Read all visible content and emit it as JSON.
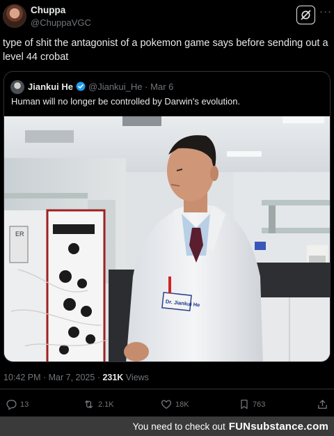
{
  "tweet": {
    "author_name": "Chuppa",
    "author_handle": "@ChuppaVGC",
    "text": "type of shit the antagonist of a pokemon game says before sending out a level 44 crobat",
    "timestamp": "10:42 PM · Mar 7, 2025 · ",
    "views_count": "231K",
    "views_label": " Views"
  },
  "quoted": {
    "author_name": "Jiankui He",
    "author_handle": "@Jiankui_He · Mar 6",
    "text": "Human will no longer be controlled by Darwin's evolution.",
    "badge_text": "Dr. Jiankui He",
    "device_label": "ER"
  },
  "actions": {
    "replies": "13",
    "reposts": "2.1K",
    "likes": "18K",
    "bookmarks": "763"
  },
  "banner": {
    "prefix": "You need to check out",
    "brand": "FUNsubstance.com"
  },
  "colors": {
    "background": "#000000",
    "text": "#e7e9ea",
    "muted": "#71767b",
    "verified": "#1d9bf0",
    "banner": "#3a3a3a"
  }
}
